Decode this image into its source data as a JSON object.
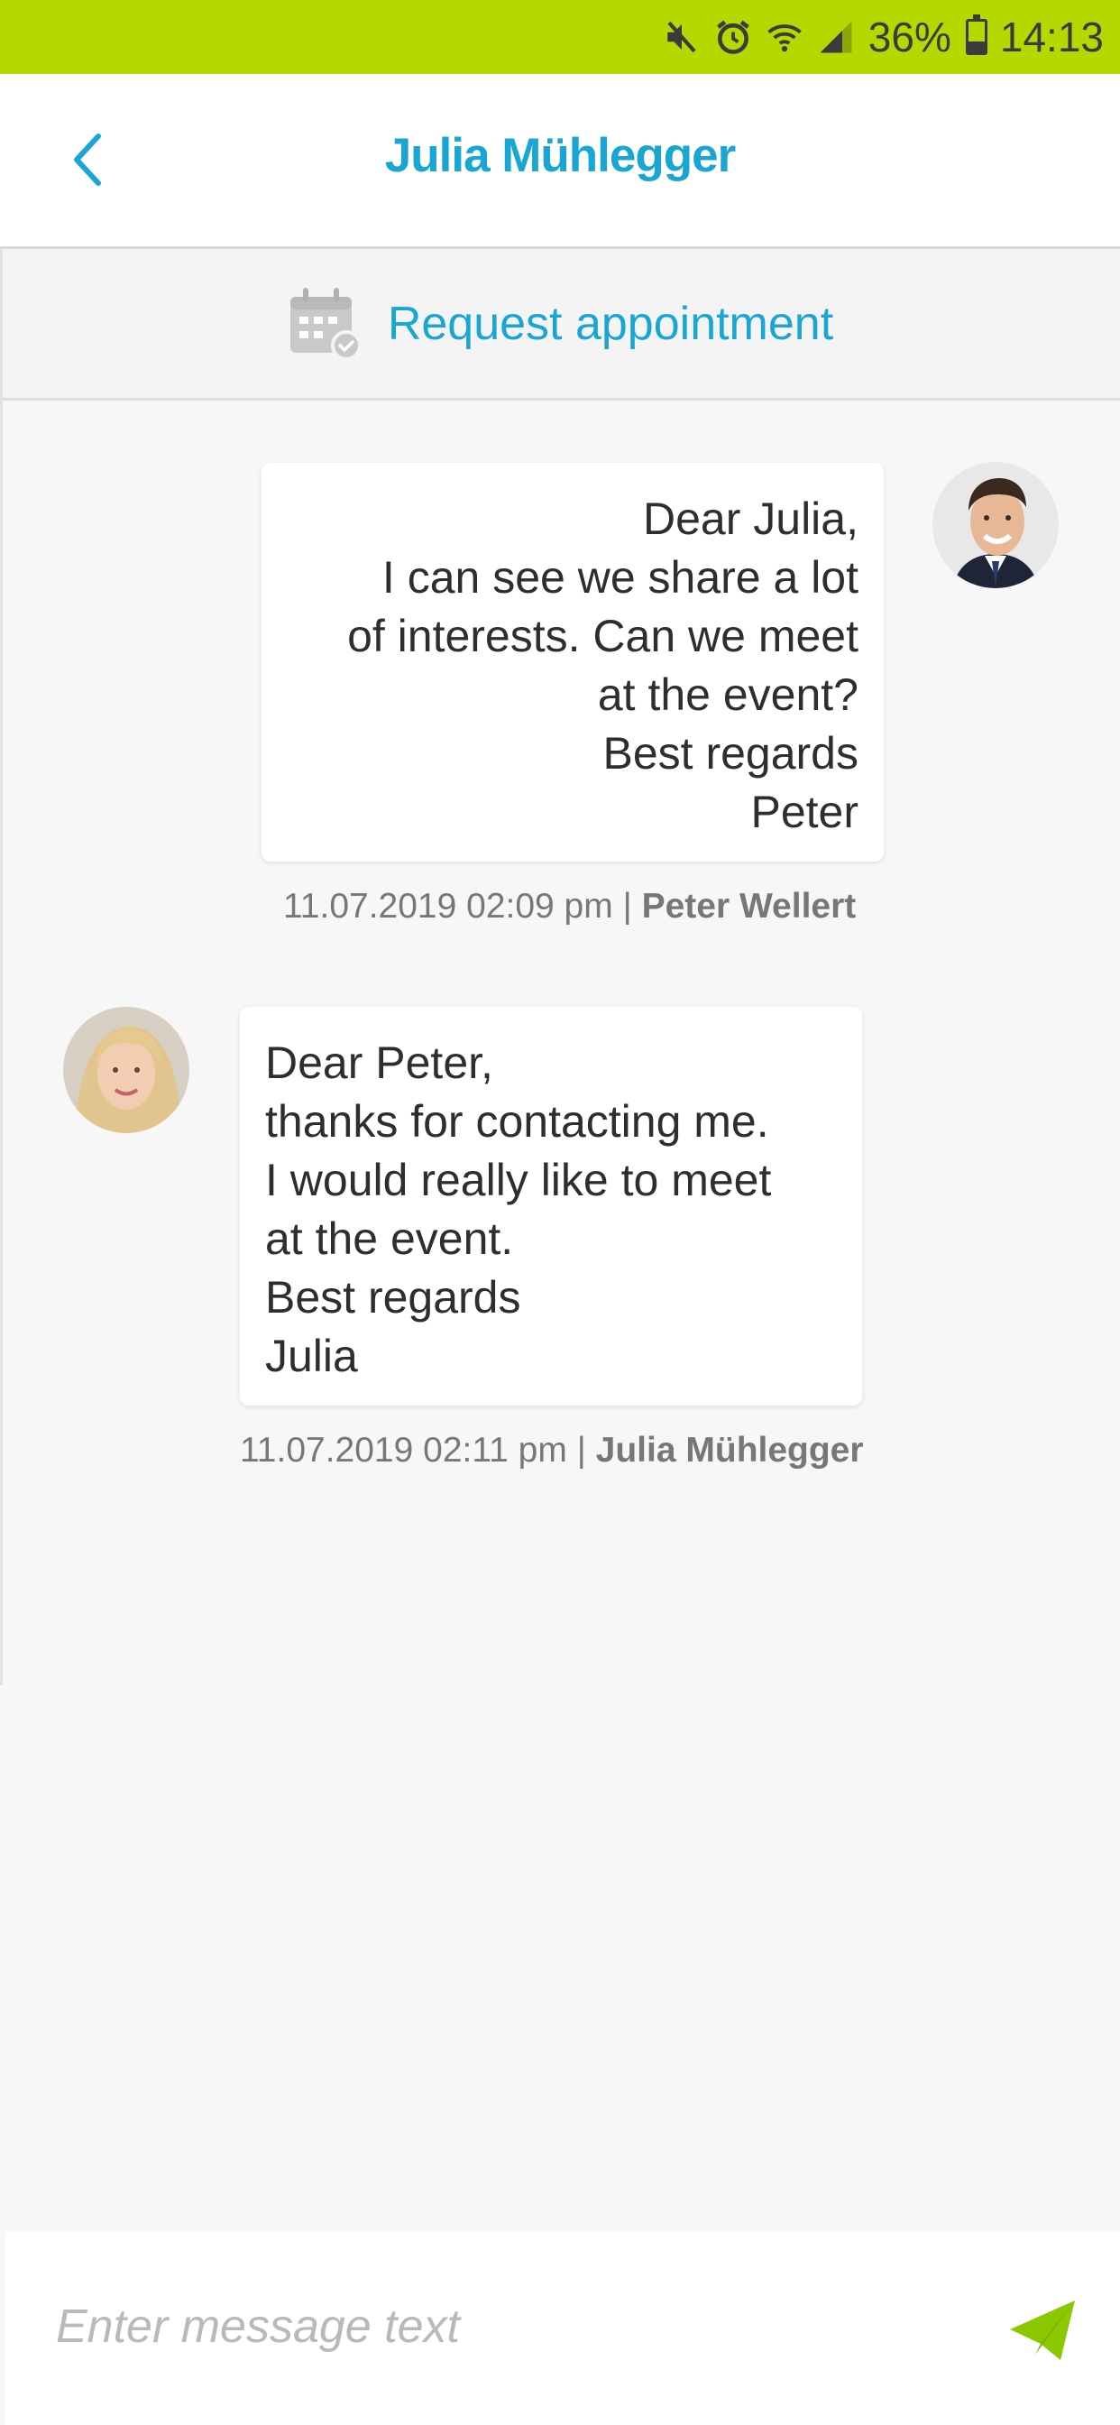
{
  "status_bar": {
    "battery": "36%",
    "battery_level": 0.36,
    "time": "14:13",
    "icons": [
      "mute-icon",
      "alarm-icon",
      "wifi-icon",
      "signal-icon",
      "battery-icon"
    ],
    "background_color": "#b5d900"
  },
  "header": {
    "title": "Julia Mühlegger",
    "back_icon": "chevron-left-icon"
  },
  "appointment": {
    "label": "Request appointment",
    "icon": "calendar-check-icon"
  },
  "messages": [
    {
      "direction": "outgoing",
      "text": "Dear Julia, \nI can see we share a lot\nof interests. Can we meet\nat the event? \nBest regards \nPeter",
      "timestamp": "11.07.2019 02:09 pm",
      "separator": " | ",
      "sender": "Peter Wellert"
    },
    {
      "direction": "incoming",
      "text": "Dear Peter,\nthanks for contacting me.\nI would really like to meet\nat the event.\nBest regards\nJulia",
      "timestamp": "11.07.2019 02:11 pm",
      "separator": " | ",
      "sender": "Julia Mühlegger"
    }
  ],
  "composer": {
    "placeholder": "Enter message text",
    "value": "",
    "send_icon": "send-icon"
  },
  "colors": {
    "accent": "#1aa6d3",
    "brand_green": "#b5d900",
    "send_green": "#8cc800"
  }
}
